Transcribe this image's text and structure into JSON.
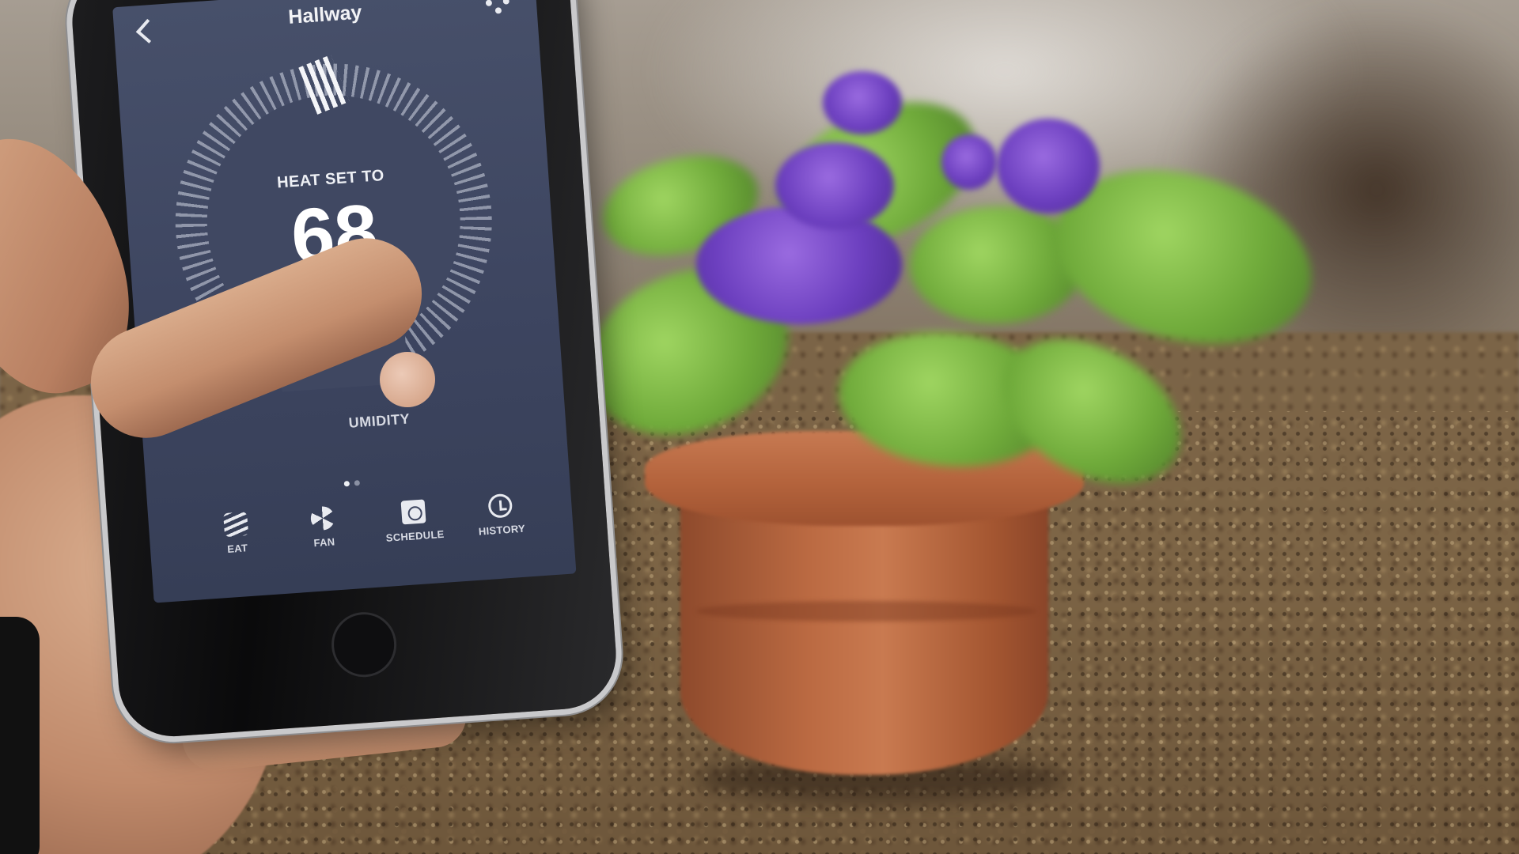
{
  "app": {
    "title": "Hallway"
  },
  "icons": {
    "back": "back-chevron-icon",
    "settings": "gear-icon",
    "heat": "heat-icon",
    "fan": "fan-icon",
    "schedule": "schedule-icon",
    "history": "history-icon"
  },
  "thermostat": {
    "mode_label": "HEAT SET TO",
    "setpoint": "68"
  },
  "secondary": {
    "humidity_label": "UMIDITY"
  },
  "pager": {
    "pages": 2,
    "active": 1
  },
  "tabs": [
    {
      "label": "EAT"
    },
    {
      "label": "FAN"
    },
    {
      "label": "SCHEDULE"
    },
    {
      "label": "HISTORY"
    }
  ],
  "colors": {
    "screen_bg": "#404862",
    "text": "#f2f3f6",
    "pot": "#b8663e",
    "flower": "#6c3fbf",
    "leaf": "#7bb543"
  }
}
